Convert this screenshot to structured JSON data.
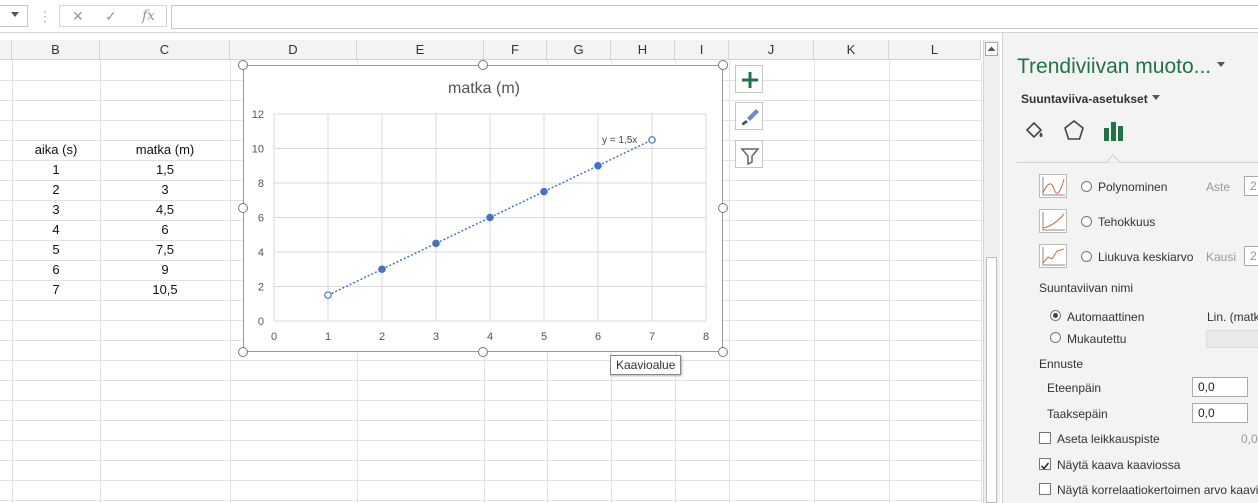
{
  "formula_bar": {
    "value": ""
  },
  "columns": [
    "B",
    "C",
    "D",
    "E",
    "F",
    "G",
    "H",
    "I",
    "J",
    "K",
    "L"
  ],
  "table": {
    "headers": [
      "aika (s)",
      "matka (m)"
    ],
    "rows": [
      [
        "1",
        "1,5"
      ],
      [
        "2",
        "3"
      ],
      [
        "3",
        "4,5"
      ],
      [
        "4",
        "6"
      ],
      [
        "5",
        "7,5"
      ],
      [
        "6",
        "9"
      ],
      [
        "7",
        "10,5"
      ]
    ]
  },
  "chart_data": {
    "type": "scatter",
    "title": "matka (m)",
    "x": [
      1,
      2,
      3,
      4,
      5,
      6,
      7
    ],
    "y": [
      1.5,
      3,
      4.5,
      6,
      7.5,
      9,
      10.5
    ],
    "xlim": [
      0,
      8
    ],
    "ylim": [
      0,
      12
    ],
    "x_ticks": [
      "0",
      "1",
      "2",
      "3",
      "4",
      "5",
      "6",
      "7",
      "8"
    ],
    "y_ticks": [
      "0",
      "2",
      "4",
      "6",
      "8",
      "10",
      "12"
    ],
    "grid": true,
    "trendline": {
      "type": "linear",
      "equation": "y = 1,5x"
    },
    "series_color": "#4472c4"
  },
  "tooltip": "Kaavioalue",
  "pane": {
    "title": "Trendiviivan muoto...",
    "subtitle": "Suuntaviiva-asetukset",
    "options": [
      {
        "label": "Polynominen",
        "param_label": "Aste",
        "param_value": "2"
      },
      {
        "label": "Tehokkuus"
      },
      {
        "label": "Liukuva keskiarvo",
        "param_label": "Kausi",
        "param_value": "2"
      }
    ],
    "name_section": "Suuntaviivan nimi",
    "auto_label": "Automaattinen",
    "auto_value": "Lin. (matka (m))",
    "custom_label": "Mukautettu",
    "forecast_section": "Ennuste",
    "forward_label": "Eteenpäin",
    "forward_value": "0,0",
    "backward_label": "Taaksepäin",
    "backward_value": "0,0",
    "intercept_label": "Aseta leikkauspiste",
    "intercept_value": "0,0",
    "show_equation_label": "Näytä kaava kaaviossa",
    "show_r2_label": "Näytä korrelaatiokertoimen arvo kaaviossa",
    "accent": "#217346"
  }
}
